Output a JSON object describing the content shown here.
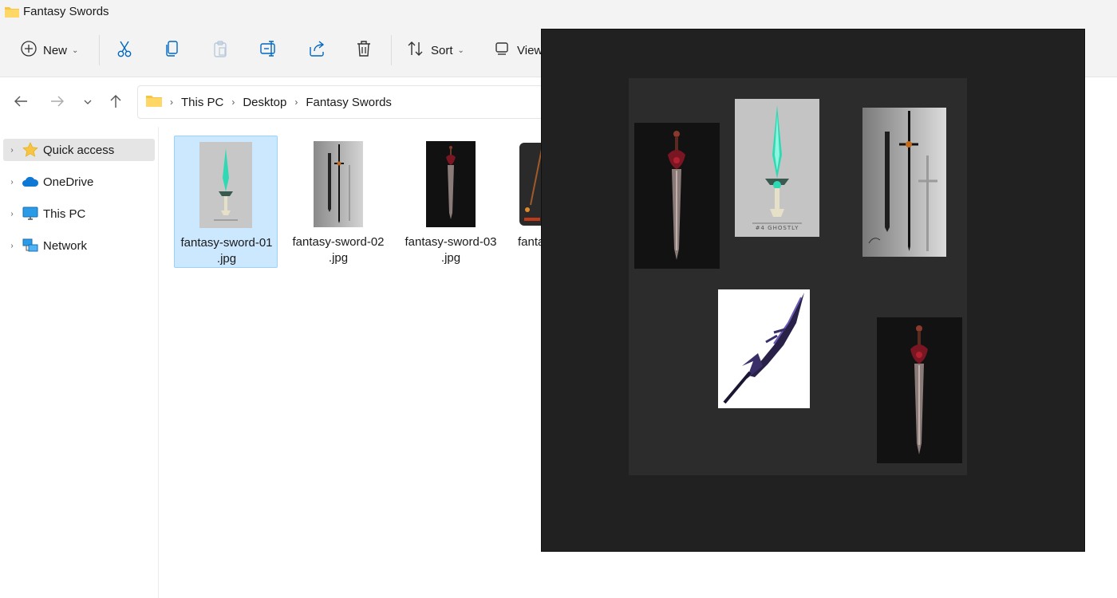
{
  "window": {
    "title": "Fantasy Swords"
  },
  "toolbar": {
    "new_label": "New",
    "sort_label": "Sort",
    "view_label": "View"
  },
  "nav": {
    "breadcrumbs": [
      "This PC",
      "Desktop",
      "Fantasy Swords"
    ]
  },
  "sidebar": {
    "items": [
      {
        "label": "Quick access",
        "icon": "star-icon"
      },
      {
        "label": "OneDrive",
        "icon": "cloud-icon"
      },
      {
        "label": "This PC",
        "icon": "monitor-icon"
      },
      {
        "label": "Network",
        "icon": "network-icon"
      }
    ]
  },
  "files": [
    {
      "name_line1": "fantasy-sword-01",
      "name_line2": ".jpg",
      "selected": true
    },
    {
      "name_line1": "fantasy-sword-02",
      "name_line2": ".jpg",
      "selected": false
    },
    {
      "name_line1": "fantasy-sword-03",
      "name_line2": ".jpg",
      "selected": false
    },
    {
      "name_line1": "fanta",
      "name_line2": "",
      "selected": false
    }
  ],
  "viewer": {
    "poster_caption": "#4 GHOSTLY"
  },
  "colors": {
    "selection": "#cce8ff",
    "folder": "#f8c542",
    "accent": "#0067c0",
    "viewer_bg": "#212121"
  }
}
